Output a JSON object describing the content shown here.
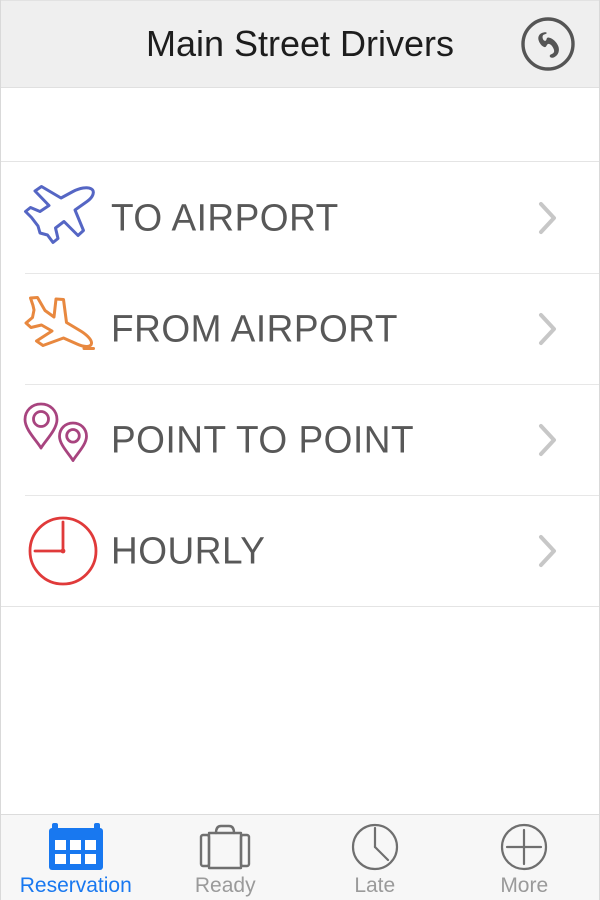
{
  "header": {
    "title": "Main Street Drivers",
    "call_icon": "phone-handset-icon",
    "background": "#efefef",
    "title_color": "#1d1d1d"
  },
  "services": {
    "rows": [
      {
        "label": "TO AIRPORT",
        "icon": "airplane-takeoff-icon",
        "icon_color": "#5566c4",
        "chevron": "chevron-right-icon"
      },
      {
        "label": "FROM AIRPORT",
        "icon": "airplane-landing-icon",
        "icon_color": "#e8883f",
        "chevron": "chevron-right-icon"
      },
      {
        "label": "POINT TO POINT",
        "icon": "map-pins-icon",
        "icon_color": "#a8447f",
        "chevron": "chevron-right-icon"
      },
      {
        "label": "HOURLY",
        "icon": "clock-icon",
        "icon_color": "#e03a3a",
        "chevron": "chevron-right-icon"
      }
    ]
  },
  "tabbar": {
    "active_color": "#1878f0",
    "inactive_color": "#9a9a9a",
    "tabs": [
      {
        "label": "Reservation",
        "icon": "calendar-icon",
        "active": true
      },
      {
        "label": "Ready",
        "icon": "briefcase-icon",
        "active": false
      },
      {
        "label": "Late",
        "icon": "clock-icon",
        "active": false
      },
      {
        "label": "More",
        "icon": "plus-circle-icon",
        "active": false
      }
    ]
  }
}
